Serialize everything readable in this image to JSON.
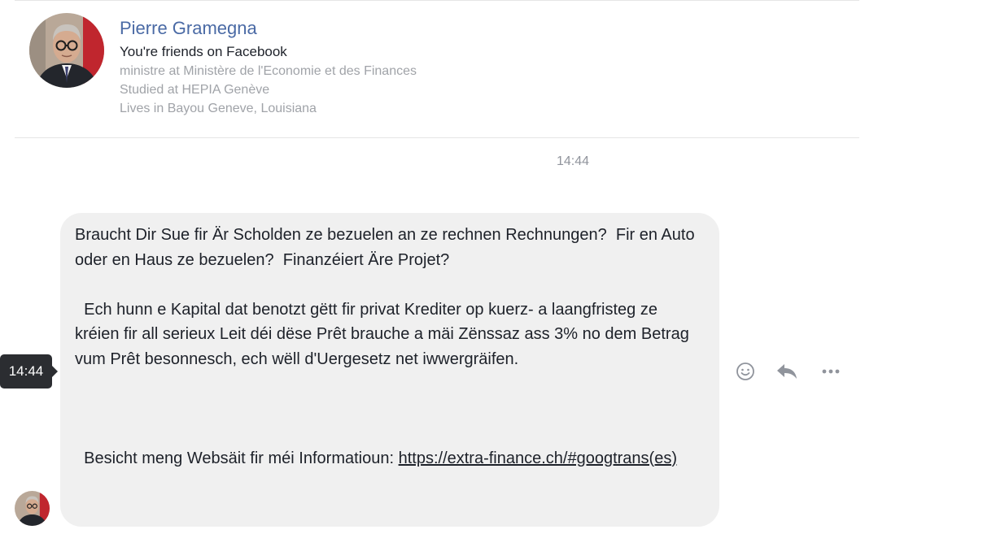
{
  "profile": {
    "name": "Pierre Gramegna",
    "friend_status": "You're friends on Facebook",
    "details": [
      "ministre at Ministère de l'Economie et des Finances",
      "Studied at HEPIA Genève",
      "Lives in Bayou Geneve, Louisiana"
    ]
  },
  "conversation": {
    "timestamp": "14:44",
    "message": {
      "hover_time": "14:44",
      "paragraph_1": "Braucht Dir Sue fir Är Scholden ze bezuelen an ze rechnen Rechnungen?  Fir en Auto oder en Haus ze bezuelen?  Finanzéiert Äre Projet?",
      "paragraph_2": "  Ech hunn e Kapital dat benotzt gëtt fir privat Krediter op kuerz- a laangfristeg ze kréien fir all serieux Leit déi dëse Prêt brauche a mäi Zënssaz ass 3% no dem Betrag vum Prêt besonnesch, ech wëll d'Uergesetz net iwwergräifen.",
      "paragraph_3_prefix": "  Besicht meng Websäit fir méi Informatioun: ",
      "link": "https://extra-finance.ch/#googtrans(es)"
    }
  },
  "actions": {
    "icons": [
      "smiley-icon",
      "reply-icon",
      "more-icon"
    ]
  },
  "colors": {
    "name_blue": "#4a6aa5",
    "bubble_bg": "#f0f0f0",
    "tooltip_bg": "#2b2d31",
    "muted_text": "#a0a3a8"
  }
}
